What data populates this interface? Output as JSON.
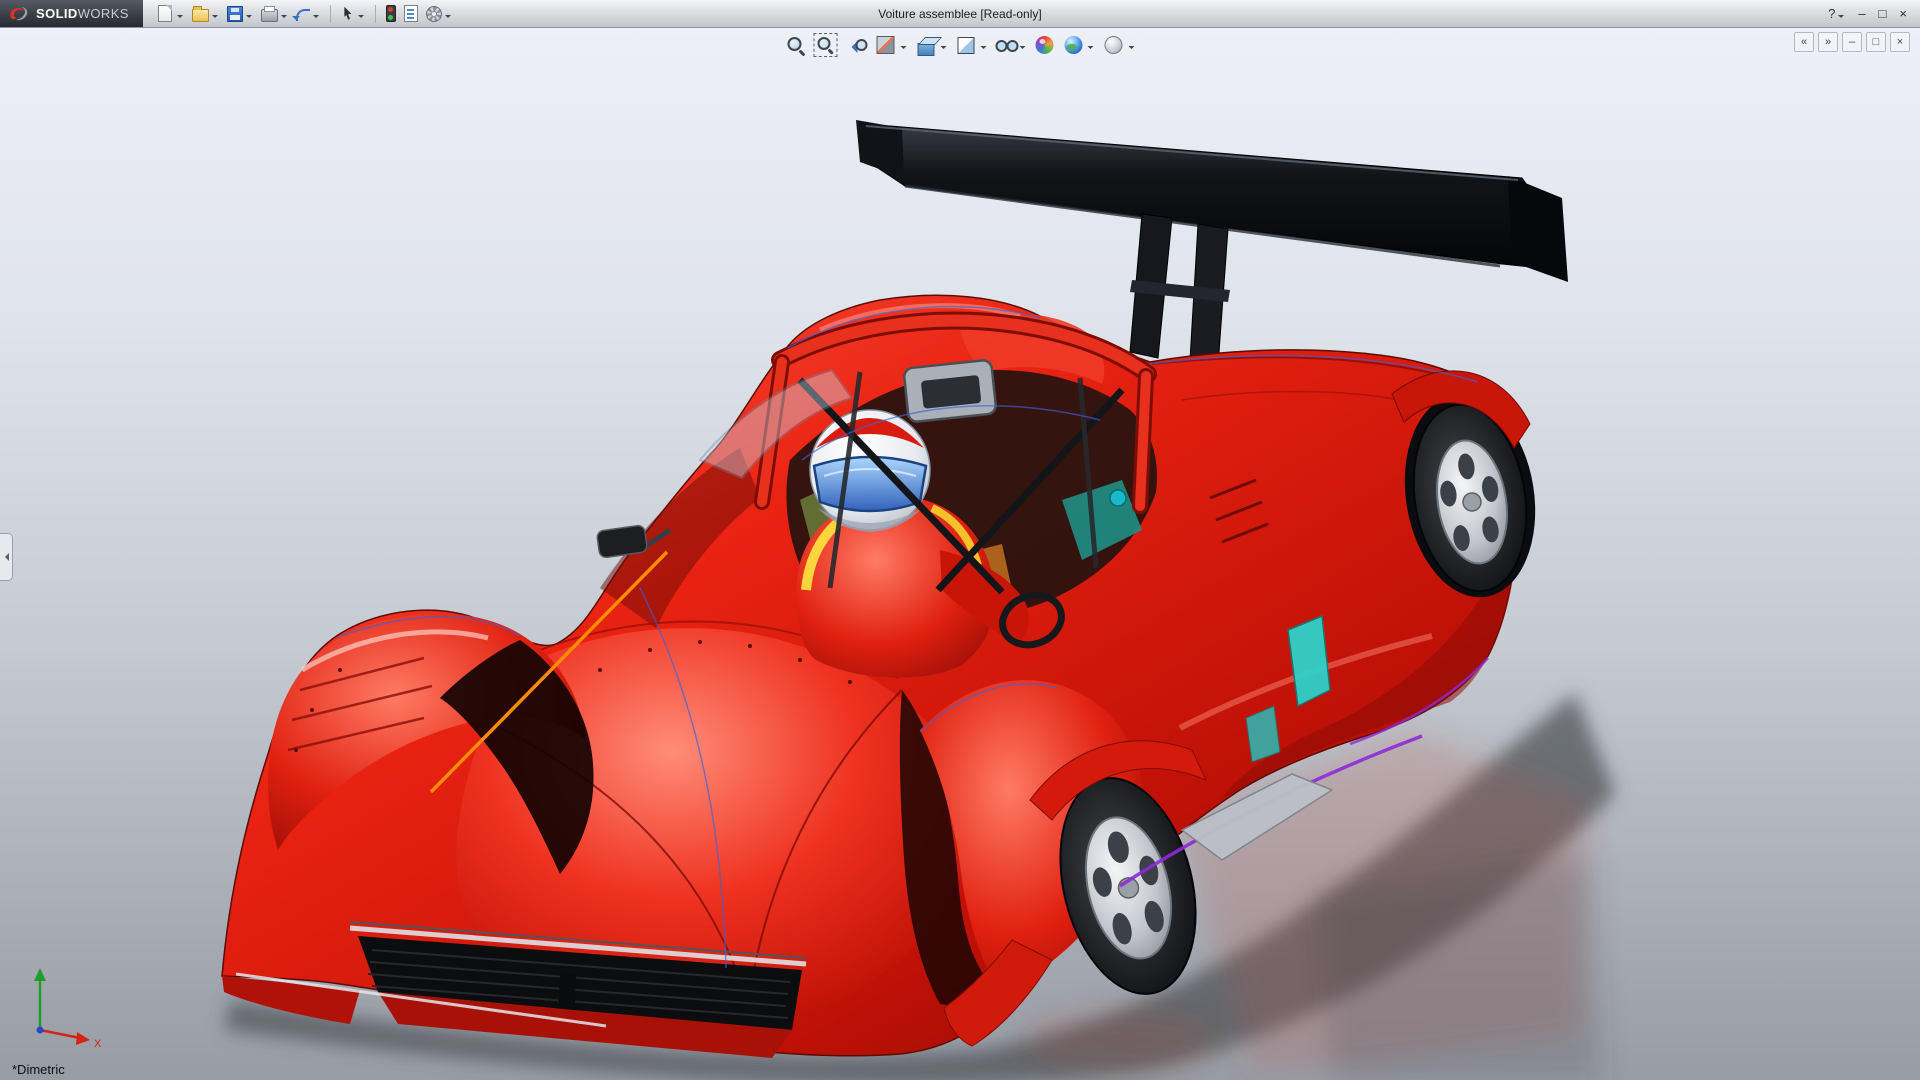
{
  "titlebar": {
    "logo": {
      "brand_bold": "SOLID",
      "brand_light": "WORKS"
    },
    "title": "Voiture assemblee [Read-only]",
    "tools": [
      {
        "name": "new-document-button",
        "icon": "page",
        "caret": true
      },
      {
        "name": "open-document-button",
        "icon": "folder",
        "caret": true
      },
      {
        "name": "save-button",
        "icon": "floppy",
        "caret": true
      },
      {
        "name": "print-button",
        "icon": "printer",
        "caret": true
      },
      {
        "name": "undo-button",
        "icon": "undo",
        "caret": true
      },
      {
        "sep": true
      },
      {
        "name": "select-tool-button",
        "icon": "cursor",
        "caret": true
      },
      {
        "sep": true
      },
      {
        "name": "rebuild-button",
        "icon": "traffic"
      },
      {
        "name": "file-properties-button",
        "icon": "props"
      },
      {
        "name": "options-button",
        "icon": "gear",
        "caret": true
      }
    ],
    "window_controls": [
      {
        "name": "help-button",
        "glyph": "?",
        "caret": true
      },
      {
        "name": "minimize-button",
        "glyph": "–"
      },
      {
        "name": "maximize-button",
        "glyph": "□"
      },
      {
        "name": "close-button",
        "glyph": "×"
      }
    ]
  },
  "headsup": {
    "tools": [
      {
        "name": "zoom-to-fit-button",
        "icon": "magnifier"
      },
      {
        "name": "zoom-to-area-button",
        "icon": "magnifier-area"
      },
      {
        "name": "previous-view-button",
        "icon": "prev-view"
      },
      {
        "name": "section-view-button",
        "icon": "section",
        "caret": true
      },
      {
        "name": "view-orientation-button",
        "icon": "cube",
        "caret": true
      },
      {
        "name": "display-style-button",
        "icon": "display-style",
        "caret": true
      },
      {
        "name": "hide-show-items-button",
        "icon": "glasses",
        "caret": true
      },
      {
        "name": "edit-appearance-button",
        "icon": "appearance-ball"
      },
      {
        "name": "apply-scene-button",
        "icon": "scene-ball",
        "caret": true
      },
      {
        "name": "view-settings-button",
        "icon": "view-settings",
        "caret": true
      }
    ]
  },
  "viewport": {
    "controls": [
      {
        "name": "pane-back-button",
        "glyph": "«"
      },
      {
        "name": "pane-forward-button",
        "glyph": "»"
      },
      {
        "name": "window-minimize-button",
        "glyph": "–"
      },
      {
        "name": "window-restore-button",
        "glyph": "□"
      },
      {
        "name": "window-close-button",
        "glyph": "×"
      }
    ],
    "view_orientation_label": "*Dimetric",
    "triad": {
      "x_label": "X"
    }
  },
  "colors": {
    "car_red": "#e31b0e",
    "wing_black": "#0d0e10",
    "background_top": "#edf0f6",
    "background_bottom": "#989ca4",
    "helmet_visor_blue": "#4a7fd4",
    "sketch_orange": "#ff8c00",
    "accent_teal": "#27d6cf",
    "accent_purple": "#8d2bd6",
    "suit_yellow": "#ffe23e"
  }
}
